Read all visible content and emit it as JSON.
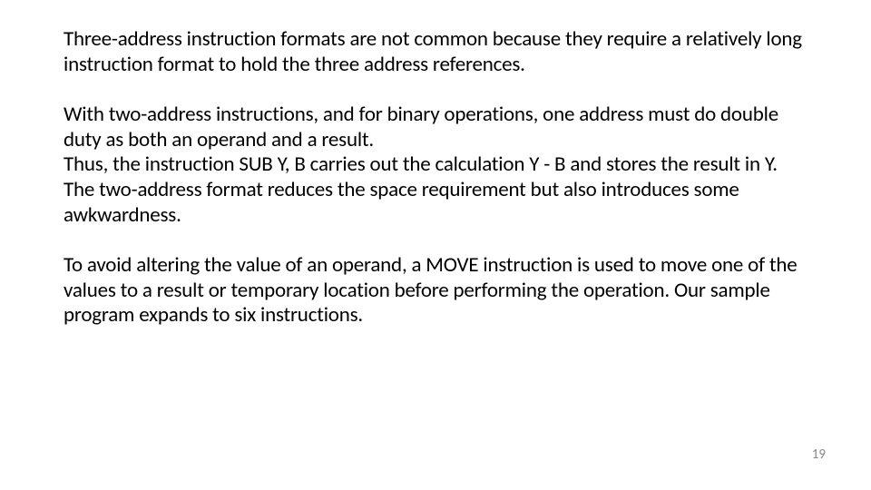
{
  "slide": {
    "para1": "Three-address instruction formats are not common because they require a relatively long instruction format to hold the three address references.",
    "para2": "With two-address instructions, and for binary operations, one address must do double duty as both an operand and a result.",
    "para3": "Thus, the instruction SUB Y, B carries out the calculation Y - B and stores the result in Y. The two-address format reduces the space requirement but also introduces some awkwardness.",
    "para4": "To avoid altering the value of an operand, a MOVE instruction is used to move one of the values to a result or temporary location before performing the operation. Our sample program expands to six instructions.",
    "pageNumber": "19"
  }
}
